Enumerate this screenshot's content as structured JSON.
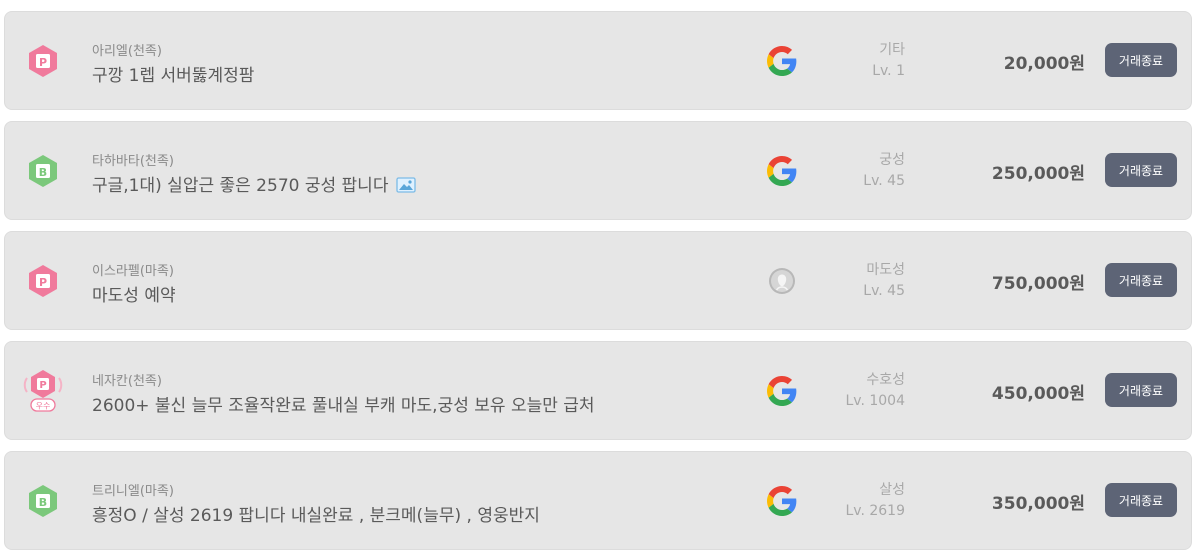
{
  "listings": [
    {
      "badge": {
        "type": "premium",
        "letter": "P",
        "color": "#f07a9c",
        "sub_label": ""
      },
      "server": "아리엘(천족)",
      "title": "구깡 1렙 서버뚫계정팜",
      "has_image": false,
      "platform_icon": "google-icon",
      "job": "기타",
      "level": "Lv. 1",
      "price": "20,000원",
      "status": "거래종료"
    },
    {
      "badge": {
        "type": "basic",
        "letter": "B",
        "color": "#7bc87b",
        "sub_label": ""
      },
      "server": "타하바타(천족)",
      "title": "구글,1대) 실압근 좋은 2570 궁성 팝니다",
      "has_image": true,
      "platform_icon": "google-icon",
      "job": "궁성",
      "level": "Lv. 45",
      "price": "250,000원",
      "status": "거래종료"
    },
    {
      "badge": {
        "type": "premium",
        "letter": "P",
        "color": "#f07a9c",
        "sub_label": ""
      },
      "server": "이스라펠(마족)",
      "title": "마도성 예약",
      "has_image": false,
      "platform_icon": "apple-icon",
      "job": "마도성",
      "level": "Lv. 45",
      "price": "750,000원",
      "status": "거래종료"
    },
    {
      "badge": {
        "type": "premium-excellent",
        "letter": "P",
        "color": "#f07a9c",
        "sub_label": "우수"
      },
      "server": "네자칸(천족)",
      "title": "2600+ 불신 늘무 조율작완료 풀내실 부캐 마도,궁성 보유 오늘만 급처",
      "has_image": false,
      "platform_icon": "google-icon",
      "job": "수호성",
      "level": "Lv. 1004",
      "price": "450,000원",
      "status": "거래종료"
    },
    {
      "badge": {
        "type": "basic",
        "letter": "B",
        "color": "#7bc87b",
        "sub_label": ""
      },
      "server": "트리니엘(마족)",
      "title": "흥정O / 살성 2619 팝니다 내실완료 , 분크메(늘무) , 영웅반지",
      "has_image": false,
      "platform_icon": "google-icon",
      "job": "살성",
      "level": "Lv. 2619",
      "price": "350,000원",
      "status": "거래종료"
    }
  ]
}
